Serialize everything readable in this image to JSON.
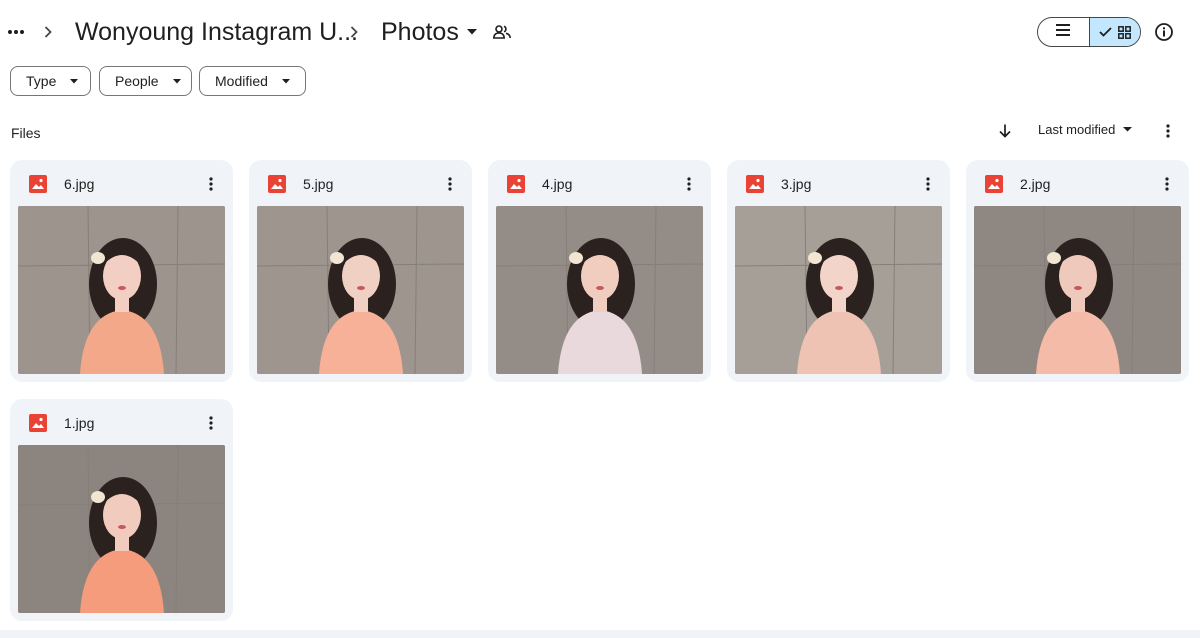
{
  "breadcrumb": {
    "folder": "Wonyoung Instagram U...",
    "current": "Photos"
  },
  "icons": {
    "more": "more-horiz-icon",
    "separator": "chevron-right-icon",
    "dropdown": "arrow-drop-down-icon",
    "shared": "people-outline-icon",
    "list_view": "list-view-icon",
    "grid_view": "grid-view-icon",
    "check": "check-icon",
    "info": "info-icon",
    "sort_direction": "arrow-downward-icon",
    "file": "image-file-icon",
    "card_menu": "more-vert-icon"
  },
  "filters": [
    "Type",
    "People",
    "Modified"
  ],
  "section_label": "Files",
  "sort": {
    "field": "Last modified",
    "direction": "descending"
  },
  "view": {
    "active": "grid"
  },
  "files": [
    {
      "name": "6.jpg",
      "type": "image"
    },
    {
      "name": "5.jpg",
      "type": "image"
    },
    {
      "name": "4.jpg",
      "type": "image"
    },
    {
      "name": "3.jpg",
      "type": "image"
    },
    {
      "name": "2.jpg",
      "type": "image"
    },
    {
      "name": "1.jpg",
      "type": "image"
    }
  ],
  "colors": {
    "accent_selected": "#c2e7ff",
    "card_background": "#f0f4f9",
    "image_icon": "#ea4335"
  }
}
